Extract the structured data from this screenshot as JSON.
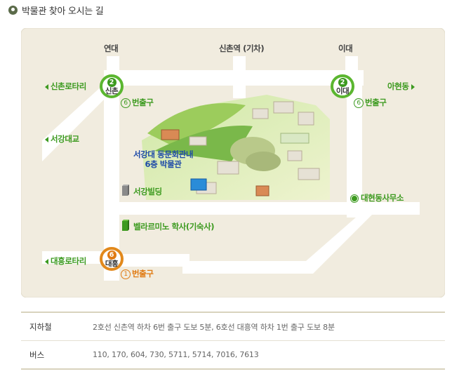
{
  "header": {
    "title": "박물관 찾아 오시는 길",
    "icon": "location-icon"
  },
  "map": {
    "top_labels": {
      "left": "연대",
      "center": "신촌역 (기차)",
      "right": "이대"
    },
    "stations": [
      {
        "line": "2",
        "name": "신촌",
        "color": "#5bb630"
      },
      {
        "line": "2",
        "name": "이대",
        "color": "#5bb630"
      },
      {
        "line": "6",
        "name": "대흥",
        "color": "#e2891c"
      }
    ],
    "exits": {
      "sinchon": {
        "num": "⑥",
        "text": "번출구"
      },
      "ewha": {
        "num": "⑥",
        "text": "번출구"
      },
      "daeheung": {
        "num": "①",
        "text": "번출구"
      }
    },
    "directions": {
      "sinchon_rotary": "신촌로타리",
      "ahyeon": "아현동",
      "seogang_bridge": "서강대교",
      "daeheung_rotary": "대흥로타리",
      "daehyeon_office": "대현동사무소"
    },
    "museum": {
      "line1": "서강대 동문회관내",
      "line2": "6층 박물관"
    },
    "buildings": {
      "seogang": "서강빌딩",
      "bellarmino": "벨라르미노 학사(기숙사)"
    },
    "colors": {
      "background": "#f1ecdf",
      "road": "#ffffff",
      "green": "#3c9a1f",
      "orange": "#e07a12",
      "blue": "#1e4aa8"
    }
  },
  "info": {
    "rows": [
      {
        "label": "지하철",
        "value": "2호선 신촌역 하차 6번 출구 도보 5분,  6호선 대흥역 하차 1번 출구 도보 8분"
      },
      {
        "label": "버스",
        "value": "110, 170, 604, 730, 5711, 5714, 7016, 7613"
      }
    ]
  }
}
